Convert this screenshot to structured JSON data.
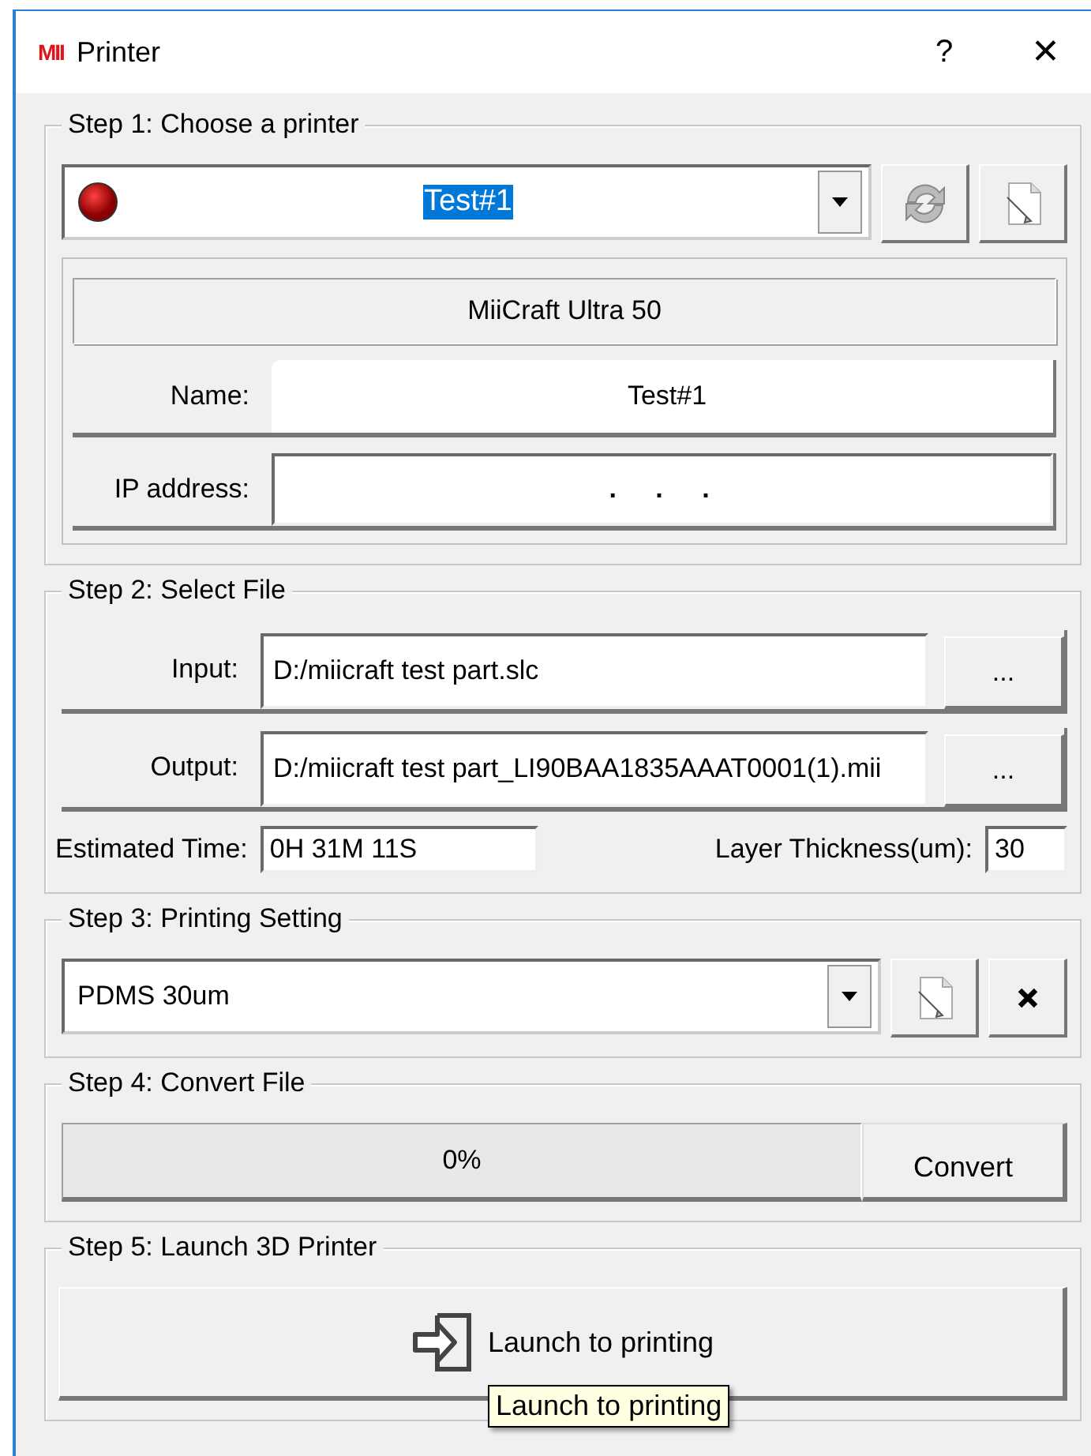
{
  "window": {
    "logo": "MII",
    "title": "Printer",
    "help": "?",
    "close": "✕"
  },
  "step1": {
    "title": "Step 1: Choose a printer",
    "printer": "Test#1",
    "model": "MiiCraft Ultra 50",
    "name_label": "Name:",
    "name": "Test#1",
    "ip_label": "IP address:",
    "ip": ". . ."
  },
  "step2": {
    "title": "Step 2: Select File",
    "input_label": "Input:",
    "input": "D:/miicraft test part.slc",
    "output_label": "Output:",
    "output": "D:/miicraft test part_LI90BAA1835AAAT0001(1).mii",
    "browse": [
      "...",
      "..."
    ],
    "time_label": "Estimated Time:",
    "time": "0H 31M 11S",
    "layer_label": "Layer Thickness(um):",
    "layer": "30"
  },
  "step3": {
    "title": "Step 3: Printing Setting",
    "setting": "PDMS 30um"
  },
  "step4": {
    "title": "Step 4: Convert File",
    "progress": {
      "level": 0,
      "text": "0%"
    },
    "convert": "Convert"
  },
  "step5": {
    "title": "Step 5: Launch 3D Printer",
    "launch": "Launch to printing",
    "tooltip": "Launch to printing"
  }
}
